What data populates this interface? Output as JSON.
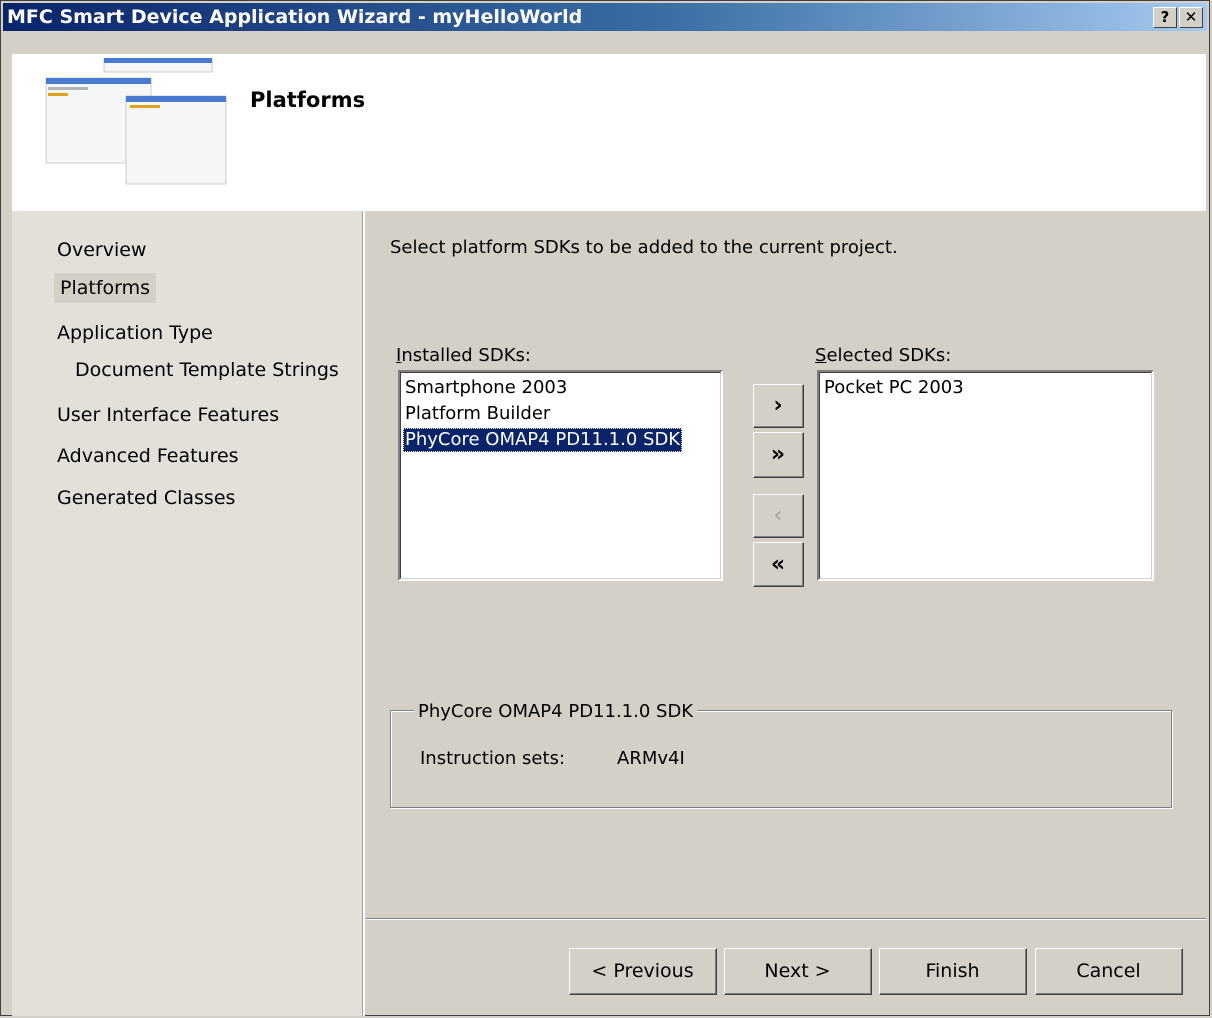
{
  "window": {
    "title": "MFC Smart Device Application Wizard - myHelloWorld",
    "help_label": "?",
    "close_label": "✕"
  },
  "header": {
    "title": "Platforms",
    "image_icon": "wizard-windows-icon"
  },
  "nav": {
    "items": [
      {
        "label": "Overview"
      },
      {
        "label": "Platforms"
      },
      {
        "label": "Application Type"
      },
      {
        "label": "Document Template Strings"
      },
      {
        "label": "User Interface Features"
      },
      {
        "label": "Advanced Features"
      },
      {
        "label": "Generated Classes"
      }
    ],
    "selected": "Platforms"
  },
  "content": {
    "instructions": "Select platform SDKs to be added to the current project.",
    "installed": {
      "label_key": "I",
      "label_rest": "nstalled SDKs:",
      "items": [
        "Smartphone 2003",
        "Platform Builder",
        "PhyCore OMAP4 PD11.1.0 SDK"
      ],
      "selected": "PhyCore OMAP4 PD11.1.0 SDK"
    },
    "selected_sdks": {
      "label_key": "S",
      "label_rest": "elected SDKs:",
      "items": [
        "Pocket PC 2003"
      ]
    },
    "move_buttons": {
      "add_one": "›",
      "add_all": "»",
      "remove_one": "‹",
      "remove_all": "«"
    },
    "group": {
      "legend": "PhyCore OMAP4 PD11.1.0 SDK",
      "field_label": "Instruction sets:",
      "field_value": "ARMv4I"
    }
  },
  "footer": {
    "previous": "< Previous",
    "next": "Next >",
    "finish": "Finish",
    "cancel": "Cancel"
  }
}
